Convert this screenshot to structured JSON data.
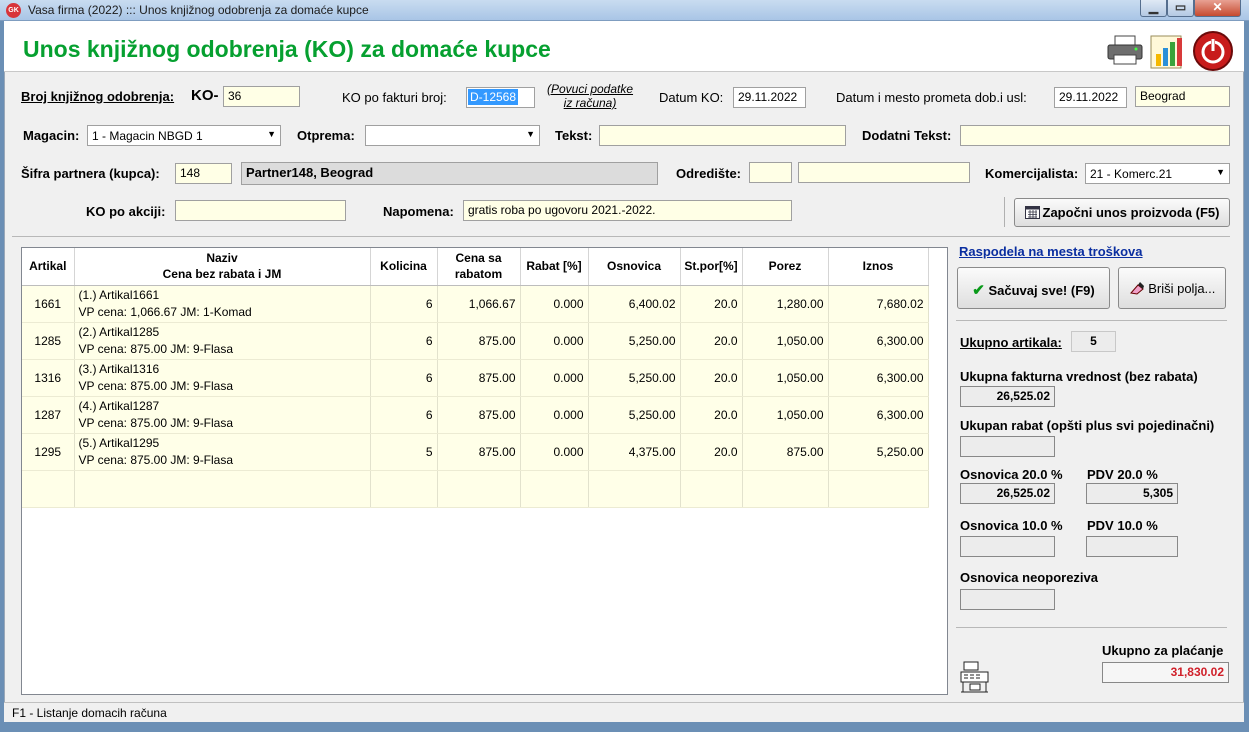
{
  "window": {
    "title": "Vasa firma (2022) ::: Unos knjižnog odobrenja za domaće kupce",
    "app_icon_text": "GK"
  },
  "header": {
    "title": "Unos knjižnog odobrenja (KO) za domaće kupce"
  },
  "form": {
    "broj_label": "Broj knjižnog odobrenja:",
    "ko_prefix": "KO-",
    "broj_value": "36",
    "po_fakturi_label": "KO po fakturi broj:",
    "po_fakturi_value": "D-12568",
    "povuci_line1": "(Povuci podatke",
    "povuci_line2": "iz računa)",
    "datum_ko_label": "Datum KO:",
    "datum_ko_value": "29.11.2022",
    "datum_prometa_label": "Datum i mesto prometa dob.i usl:",
    "datum_prometa_value": "29.11.2022",
    "mesto_value": "Beograd",
    "magacin_label": "Magacin:",
    "magacin_value": "1 - Magacin NBGD 1",
    "otprema_label": "Otprema:",
    "otprema_value": "",
    "tekst_label": "Tekst:",
    "tekst_value": "",
    "dodatni_label": "Dodatni Tekst:",
    "dodatni_value": "",
    "sifra_label": "Šifra partnera (kupca):",
    "sifra_value": "148",
    "partner_name": "Partner148, Beograd",
    "odrediste_label": "Odredište:",
    "odrediste_code": "",
    "odrediste_name": "",
    "komerc_label": "Komercijalista:",
    "komerc_value": "21 - Komerc.21",
    "akcija_label": "KO po akciji:",
    "akcija_value": "",
    "napomena_label": "Napomena:",
    "napomena_value": "gratis roba po ugovoru 2021.-2022.",
    "zapocni_label": "Započni unos proizvoda (F5)"
  },
  "grid": {
    "columns": [
      "Artikal",
      "Naziv",
      "Cena bez rabata i JM",
      "Kolicina",
      "Cena sa",
      "rabatom",
      "Rabat [%]",
      "Osnovica",
      "St.por[%]",
      "Porez",
      "Iznos"
    ],
    "rows": [
      {
        "artikal": "1661",
        "naziv": "(1.)  Artikal1661",
        "cena_jm": "VP cena: 1,066.67  JM: 1-Komad",
        "kolicina": "6",
        "cena": "1,066.67",
        "rabat": "0.000",
        "osnovica": "6,400.02",
        "stopa": "20.0",
        "porez": "1,280.00",
        "iznos": "7,680.02"
      },
      {
        "artikal": "1285",
        "naziv": "(2.)  Artikal1285",
        "cena_jm": "VP cena: 875.00  JM: 9-Flasa",
        "kolicina": "6",
        "cena": "875.00",
        "rabat": "0.000",
        "osnovica": "5,250.00",
        "stopa": "20.0",
        "porez": "1,050.00",
        "iznos": "6,300.00"
      },
      {
        "artikal": "1316",
        "naziv": "(3.)  Artikal1316",
        "cena_jm": "VP cena: 875.00  JM: 9-Flasa",
        "kolicina": "6",
        "cena": "875.00",
        "rabat": "0.000",
        "osnovica": "5,250.00",
        "stopa": "20.0",
        "porez": "1,050.00",
        "iznos": "6,300.00"
      },
      {
        "artikal": "1287",
        "naziv": "(4.)  Artikal1287",
        "cena_jm": "VP cena: 875.00  JM: 9-Flasa",
        "kolicina": "6",
        "cena": "875.00",
        "rabat": "0.000",
        "osnovica": "5,250.00",
        "stopa": "20.0",
        "porez": "1,050.00",
        "iznos": "6,300.00"
      },
      {
        "artikal": "1295",
        "naziv": "(5.)  Artikal1295",
        "cena_jm": "VP cena: 875.00  JM: 9-Flasa",
        "kolicina": "5",
        "cena": "875.00",
        "rabat": "0.000",
        "osnovica": "4,375.00",
        "stopa": "20.0",
        "porez": "875.00",
        "iznos": "5,250.00"
      }
    ]
  },
  "side": {
    "raspodela_link": "Raspodela na mesta troškova",
    "sacuvaj_label": "Sačuvaj sve! (F9)",
    "brisi_label": "Briši polja...",
    "ukupno_artikala_label": "Ukupno artikala:",
    "ukupno_artikala_value": "5",
    "fakturna_label": "Ukupna fakturna vrednost (bez rabata)",
    "fakturna_value": "26,525.02",
    "rabat_label": "Ukupan rabat (opšti plus svi pojedinačni)",
    "rabat_value": "",
    "osnovica20_label": "Osnovica  20.0 %",
    "osnovica20_value": "26,525.02",
    "pdv20_label": "PDV  20.0 %",
    "pdv20_value": "5,305",
    "osnovica10_label": "Osnovica  10.0 %",
    "osnovica10_value": "",
    "pdv10_label": "PDV  10.0 %",
    "pdv10_value": "",
    "neoporeziva_label": "Osnovica neoporeziva",
    "neoporeziva_value": "",
    "za_placanje_label": "Ukupno za plaćanje",
    "za_placanje_value": "31,830.02"
  },
  "status": {
    "text": "F1 - Listanje domacih računa"
  },
  "colors": {
    "title_green": "#06a030",
    "total_red": "#d0202a",
    "field_yellow": "#ffffe6",
    "link_blue": "#0a2ea0",
    "selection_blue": "#3399ff"
  },
  "icons": [
    "printer-icon",
    "chart-icon",
    "power-icon",
    "calendar-icon",
    "checkmark-icon",
    "eraser-icon",
    "cash-register-icon"
  ]
}
